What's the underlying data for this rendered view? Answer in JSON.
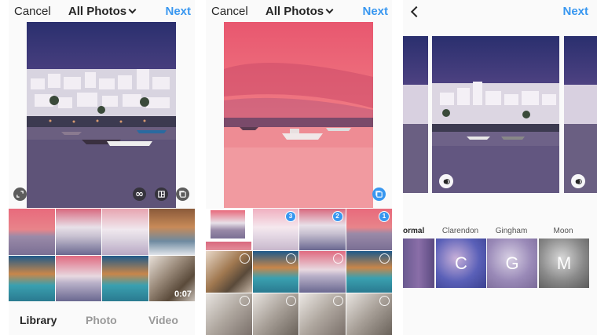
{
  "panel1": {
    "cancel": "Cancel",
    "title": "All Photos",
    "next": "Next",
    "tabs": {
      "library": "Library",
      "photo": "Photo",
      "video": "Video"
    },
    "video_duration": "0:07"
  },
  "panel2": {
    "cancel": "Cancel",
    "title": "All Photos",
    "next": "Next",
    "badges": [
      "3",
      "2",
      "1"
    ]
  },
  "panel3": {
    "next": "Next",
    "filters": [
      {
        "name": "Normal",
        "letter": ""
      },
      {
        "name": "Clarendon",
        "letter": "C"
      },
      {
        "name": "Gingham",
        "letter": "G"
      },
      {
        "name": "Moon",
        "letter": "M"
      }
    ]
  },
  "colors": {
    "accent": "#3897f0",
    "text": "#262626",
    "muted": "#c7c7c7"
  }
}
